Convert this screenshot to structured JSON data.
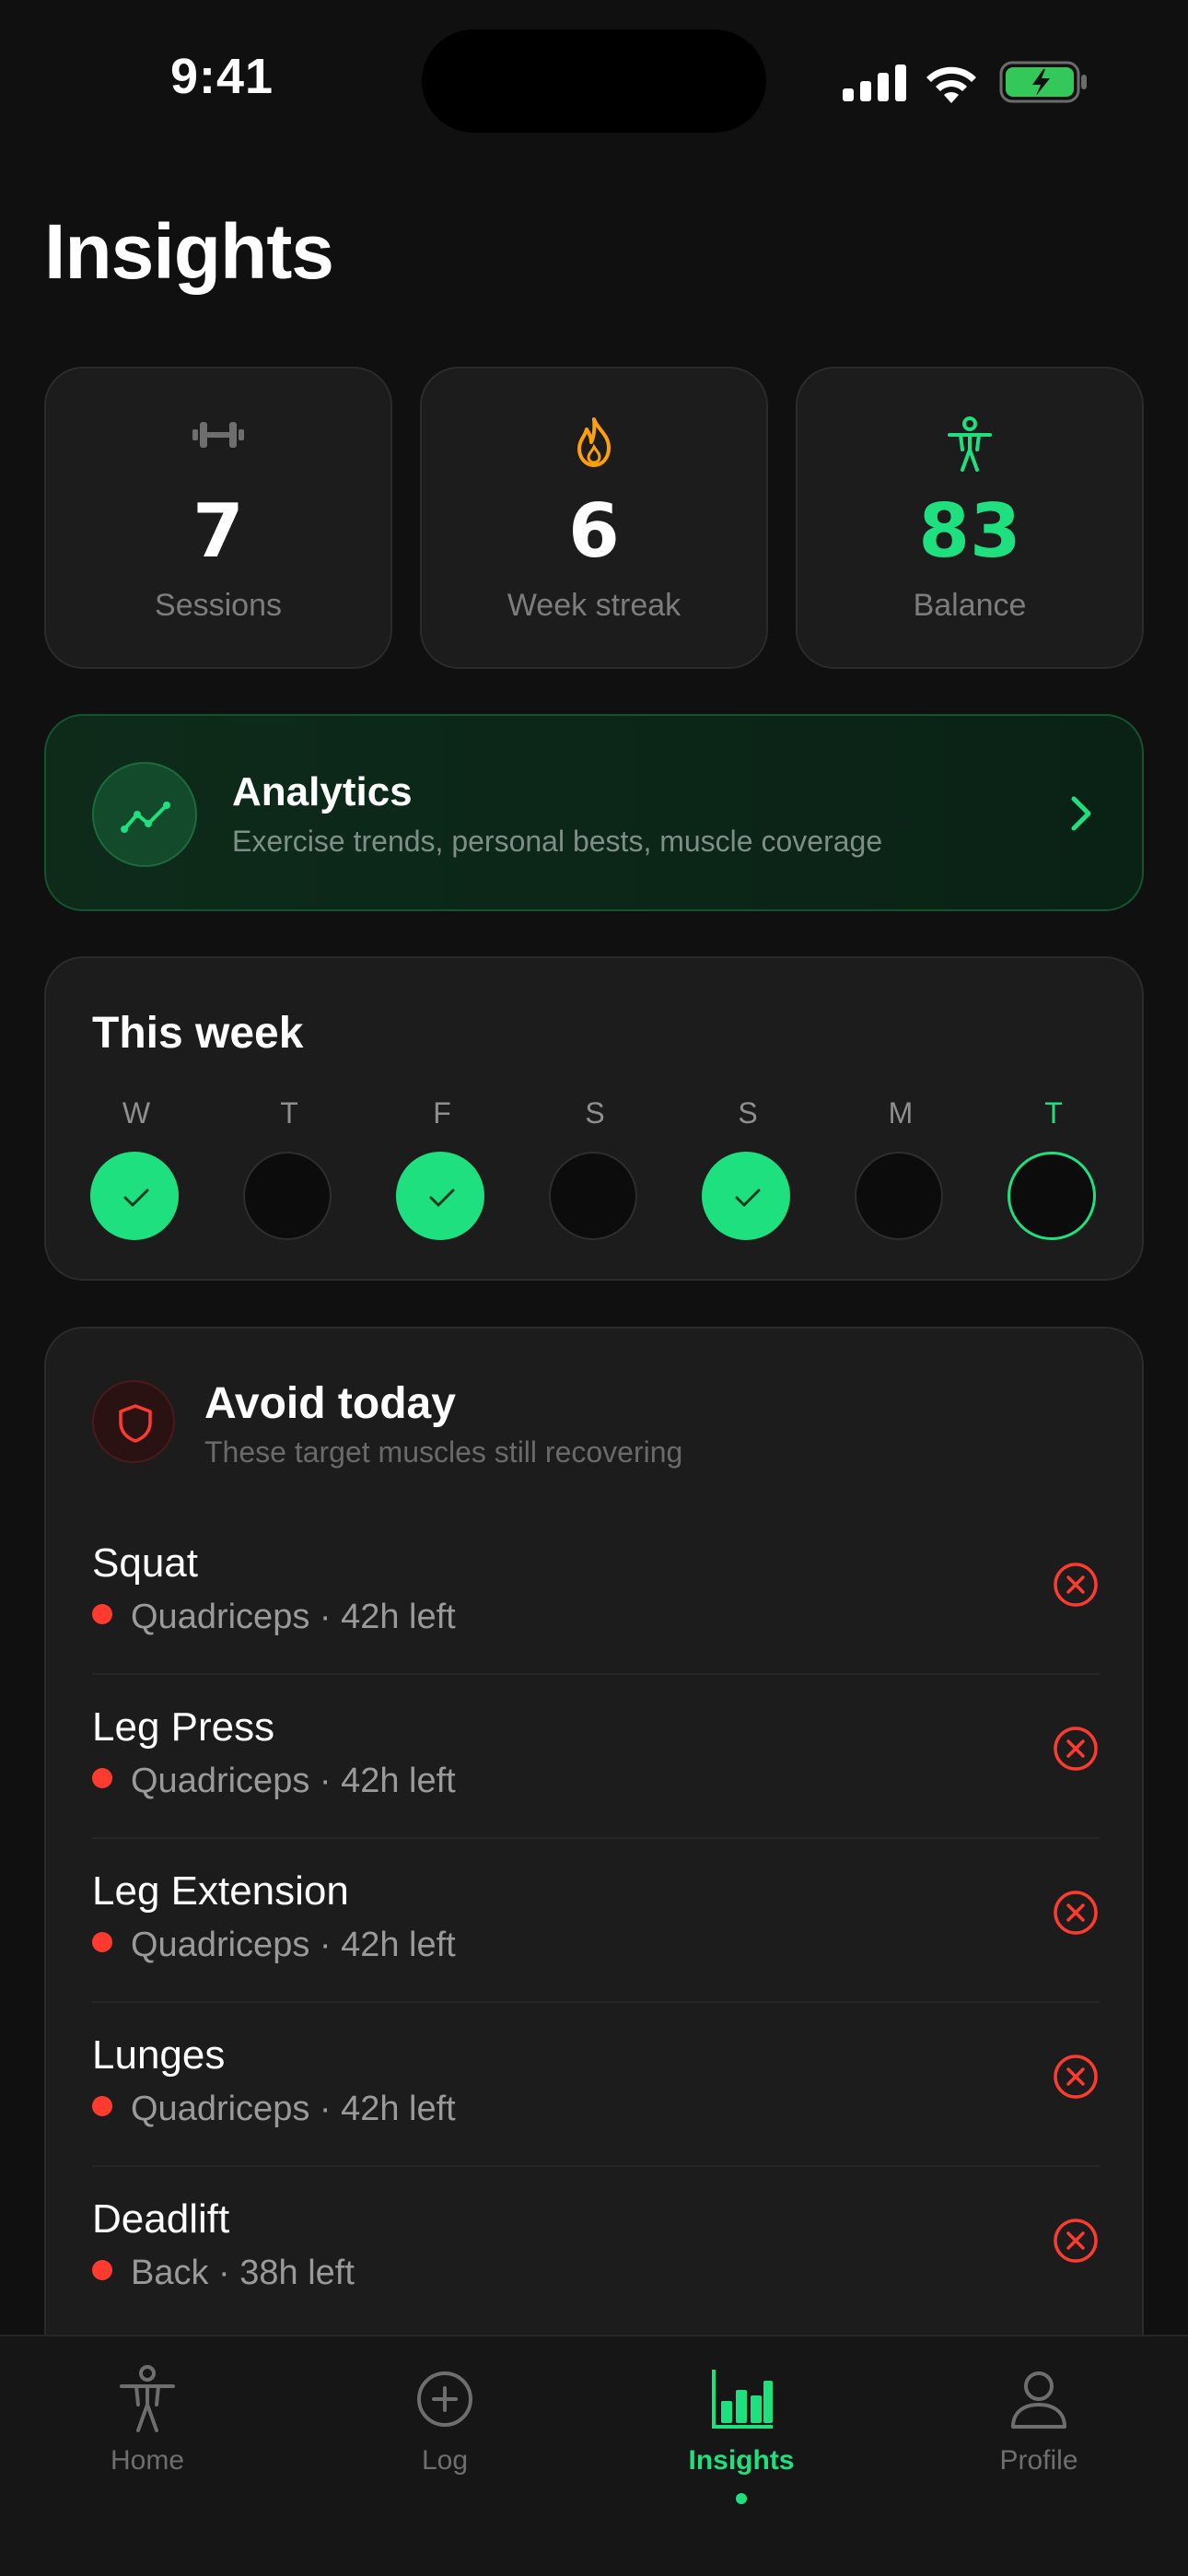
{
  "status_bar": {
    "time": "9:41"
  },
  "page": {
    "title": "Insights"
  },
  "stats": [
    {
      "icon": "dumbbell-icon",
      "value": "7",
      "label": "Sessions",
      "value_color": "#ffffff"
    },
    {
      "icon": "flame-icon",
      "value": "6",
      "label": "Week streak",
      "value_color": "#ffffff"
    },
    {
      "icon": "body-figure-icon",
      "value": "83",
      "label": "Balance",
      "value_color": "#1fe07f"
    }
  ],
  "analytics": {
    "title": "Analytics",
    "subtitle": "Exercise trends, personal bests, muscle coverage",
    "icon": "trend-line-icon"
  },
  "week": {
    "title": "This week",
    "days": [
      {
        "letter": "W",
        "state": "done"
      },
      {
        "letter": "T",
        "state": "empty"
      },
      {
        "letter": "F",
        "state": "done"
      },
      {
        "letter": "S",
        "state": "empty"
      },
      {
        "letter": "S",
        "state": "done"
      },
      {
        "letter": "M",
        "state": "empty"
      },
      {
        "letter": "T",
        "state": "today"
      }
    ]
  },
  "avoid": {
    "title": "Avoid today",
    "subtitle": "These target muscles still recovering",
    "exercises": [
      {
        "name": "Squat",
        "detail": "Quadriceps · 42h left"
      },
      {
        "name": "Leg Press",
        "detail": "Quadriceps · 42h left"
      },
      {
        "name": "Leg Extension",
        "detail": "Quadriceps · 42h left"
      },
      {
        "name": "Lunges",
        "detail": "Quadriceps · 42h left"
      },
      {
        "name": "Deadlift",
        "detail": "Back · 38h left"
      }
    ]
  },
  "tabs": [
    {
      "label": "Home",
      "icon": "body-figure-icon"
    },
    {
      "label": "Log",
      "icon": "plus-circle-icon"
    },
    {
      "label": "Insights",
      "icon": "bar-chart-icon",
      "active": true
    },
    {
      "label": "Profile",
      "icon": "person-icon"
    }
  ],
  "colors": {
    "accent": "#1fe07f",
    "danger": "#ff3b30",
    "card": "#1c1c1c",
    "background": "#101010"
  }
}
